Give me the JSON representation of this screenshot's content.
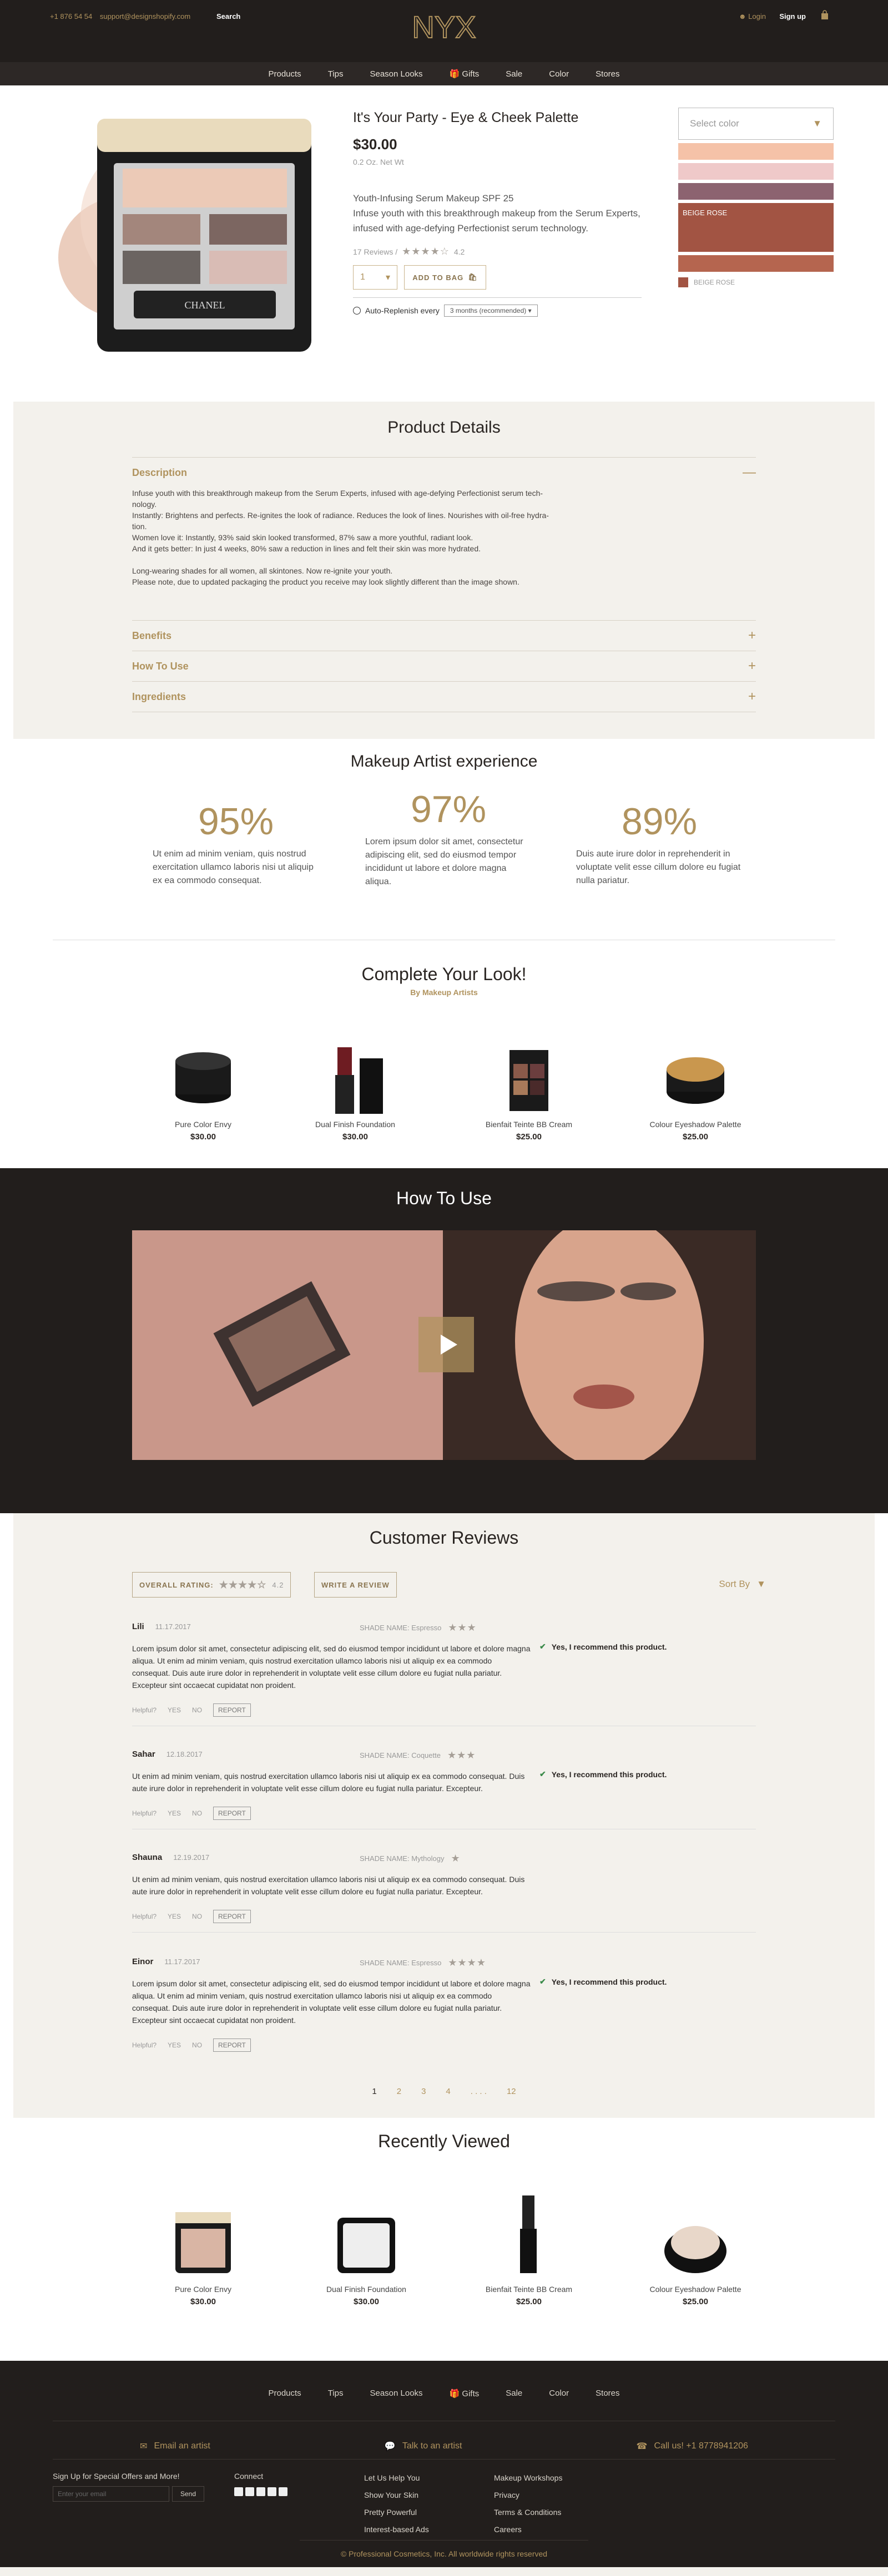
{
  "header": {
    "phone": "+1 876 54 54",
    "email": "support@designshopify.com",
    "search_label": "Search",
    "logo_text": "NYX",
    "login_label": "Login",
    "signup_label": "Sign up"
  },
  "nav": [
    "Products",
    "Tips",
    "Season Looks",
    "Gifts",
    "Sale",
    "Color",
    "Stores"
  ],
  "product": {
    "title": "It's Your Party - Eye & Cheek Palette",
    "price": "$30.00",
    "size": "0.2 Oz. Net Wt",
    "desc_title": "Youth-Infusing Serum Makeup SPF 25",
    "desc_body": "Infuse youth with this breakthrough makeup from the Serum Experts, infused with age-defying Perfectionist serum technology.",
    "reviews_count": "17 Reviews /",
    "rating": "4.2",
    "qty": "1",
    "add_bag": "ADD TO BAG",
    "replenish_label": "Auto-Replenish every",
    "replenish_value": "3 months (recommended)",
    "select_color": "Select color",
    "selected_swatch_label": "BEIGE ROSE",
    "selected_caption": "BEIGE ROSE",
    "swatches": [
      "#f5c2a8",
      "#efc9c9",
      "#8c6370",
      "#a25443",
      "#b5654f"
    ]
  },
  "details": {
    "title": "Product Details",
    "description_label": "Description",
    "description_lines": [
      "Infuse youth with this breakthrough makeup from the Serum Experts, infused with age-defying Perfectionist serum tech-",
      "nology.",
      "Instantly: Brightens and perfects. Re-ignites the look of radiance. Reduces the look of lines. Nourishes with oil-free hydra-",
      "tion.",
      "Women love it: Instantly, 93% said skin looked transformed, 87% saw a more youthful, radiant look.",
      "And it gets better: In just 4 weeks, 80% saw a reduction in lines and felt their skin was more hydrated.",
      "",
      "Long-wearing shades for all women, all skintones. Now re-ignite your youth.",
      "Please note, due to updated packaging the product you receive may look slightly different than the image shown."
    ],
    "benefits_label": "Benefits",
    "howto_label": "How To Use",
    "ingredients_label": "Ingredients"
  },
  "experience": {
    "title": "Makeup Artist experience",
    "stats": [
      {
        "pct": "95%",
        "text": "Ut enim ad minim veniam, quis nostrud exercitation ullamco laboris nisi ut aliquip ex ea commodo consequat."
      },
      {
        "pct": "97%",
        "text": "Lorem ipsum dolor sit amet, consectetur adipiscing elit, sed do eiusmod tempor incididunt ut labore et dolore magna aliqua."
      },
      {
        "pct": "89%",
        "text": "Duis aute irure dolor in reprehenderit in voluptate velit esse cillum dolore eu fugiat nulla pariatur."
      }
    ]
  },
  "look": {
    "title": "Complete Your Look!",
    "subtitle": "By Makeup Artists",
    "items": [
      {
        "name": "Pure Color Envy",
        "price": "$30.00"
      },
      {
        "name": "Dual Finish Foundation",
        "price": "$30.00"
      },
      {
        "name": "Bienfait Teinte BB Cream",
        "price": "$25.00"
      },
      {
        "name": "Colour Eyeshadow Palette",
        "price": "$25.00"
      }
    ]
  },
  "howto": {
    "title": "How To Use"
  },
  "reviews": {
    "title": "Customer Reviews",
    "overall_label": "OVERALL RATING:",
    "overall_value": "4.2",
    "write_label": "WRITE A REVIEW",
    "sort_label": "Sort By",
    "shade_prefix": "SHADE NAME:",
    "recommend": "Yes, I recommend this product.",
    "helpful": "Helpful?",
    "yes": "YES",
    "no": "NO",
    "report": "REPORT",
    "items": [
      {
        "name": "Lili",
        "date": "11.17.2017",
        "shade": "Espresso",
        "stars": "★★★",
        "rec": true,
        "body": "Lorem ipsum dolor sit amet, consectetur adipiscing elit, sed do eiusmod tempor incididunt ut labore et dolore magna aliqua. Ut enim ad minim veniam, quis nostrud exercitation ullamco laboris nisi ut aliquip ex ea commodo consequat. Duis aute irure dolor in reprehenderit in voluptate velit esse cillum dolore eu fugiat nulla pariatur. Excepteur sint occaecat cupidatat non proident."
      },
      {
        "name": "Sahar",
        "date": "12.18.2017",
        "shade": "Coquette",
        "stars": "★★★",
        "rec": true,
        "body": "Ut enim ad minim veniam, quis nostrud exercitation ullamco laboris nisi ut aliquip ex ea commodo consequat. Duis aute irure dolor in reprehenderit in voluptate velit esse cillum dolore eu fugiat nulla pariatur. Excepteur."
      },
      {
        "name": "Shauna",
        "date": "12.19.2017",
        "shade": "Mythology",
        "stars": "★",
        "rec": false,
        "body": "Ut enim ad minim veniam, quis nostrud exercitation ullamco laboris nisi ut aliquip ex ea commodo consequat. Duis aute irure dolor in reprehenderit in voluptate velit esse cillum dolore eu fugiat nulla pariatur. Excepteur."
      },
      {
        "name": "Einor",
        "date": "11.17.2017",
        "shade": "Espresso",
        "stars": "★★★★",
        "rec": true,
        "body": "Lorem ipsum dolor sit amet, consectetur adipiscing elit, sed do eiusmod tempor incididunt ut labore et dolore magna aliqua. Ut enim ad minim veniam, quis nostrud exercitation ullamco laboris nisi ut aliquip ex ea commodo consequat. Duis aute irure dolor in reprehenderit in voluptate velit esse cillum dolore eu fugiat nulla pariatur. Excepteur sint occaecat cupidatat non proident."
      }
    ],
    "pages": [
      "1",
      "2",
      "3",
      "4",
      ". . . .",
      "12"
    ]
  },
  "recent": {
    "title": "Recently Viewed",
    "items": [
      {
        "name": "Pure Color Envy",
        "price": "$30.00"
      },
      {
        "name": "Dual Finish Foundation",
        "price": "$30.00"
      },
      {
        "name": "Bienfait Teinte BB Cream",
        "price": "$25.00"
      },
      {
        "name": "Colour Eyeshadow Palette",
        "price": "$25.00"
      }
    ]
  },
  "footer": {
    "email_artist": "Email an artist",
    "talk_artist": "Talk to an artist",
    "call": "Call us! +1 8778941206",
    "signup_heading": "Sign Up for Special Offers and More!",
    "email_placeholder": "Enter your email",
    "send": "Send",
    "connect": "Connect",
    "links_a": [
      "Let Us Help You",
      "Show Your Skin",
      "Pretty Powerful",
      "Interest-based Ads"
    ],
    "links_b": [
      "Makeup Workshops",
      "Privacy",
      "Terms & Conditions",
      "Careers"
    ],
    "copyright": "© Professional Cosmetics, Inc. All worldwide rights reserved"
  }
}
